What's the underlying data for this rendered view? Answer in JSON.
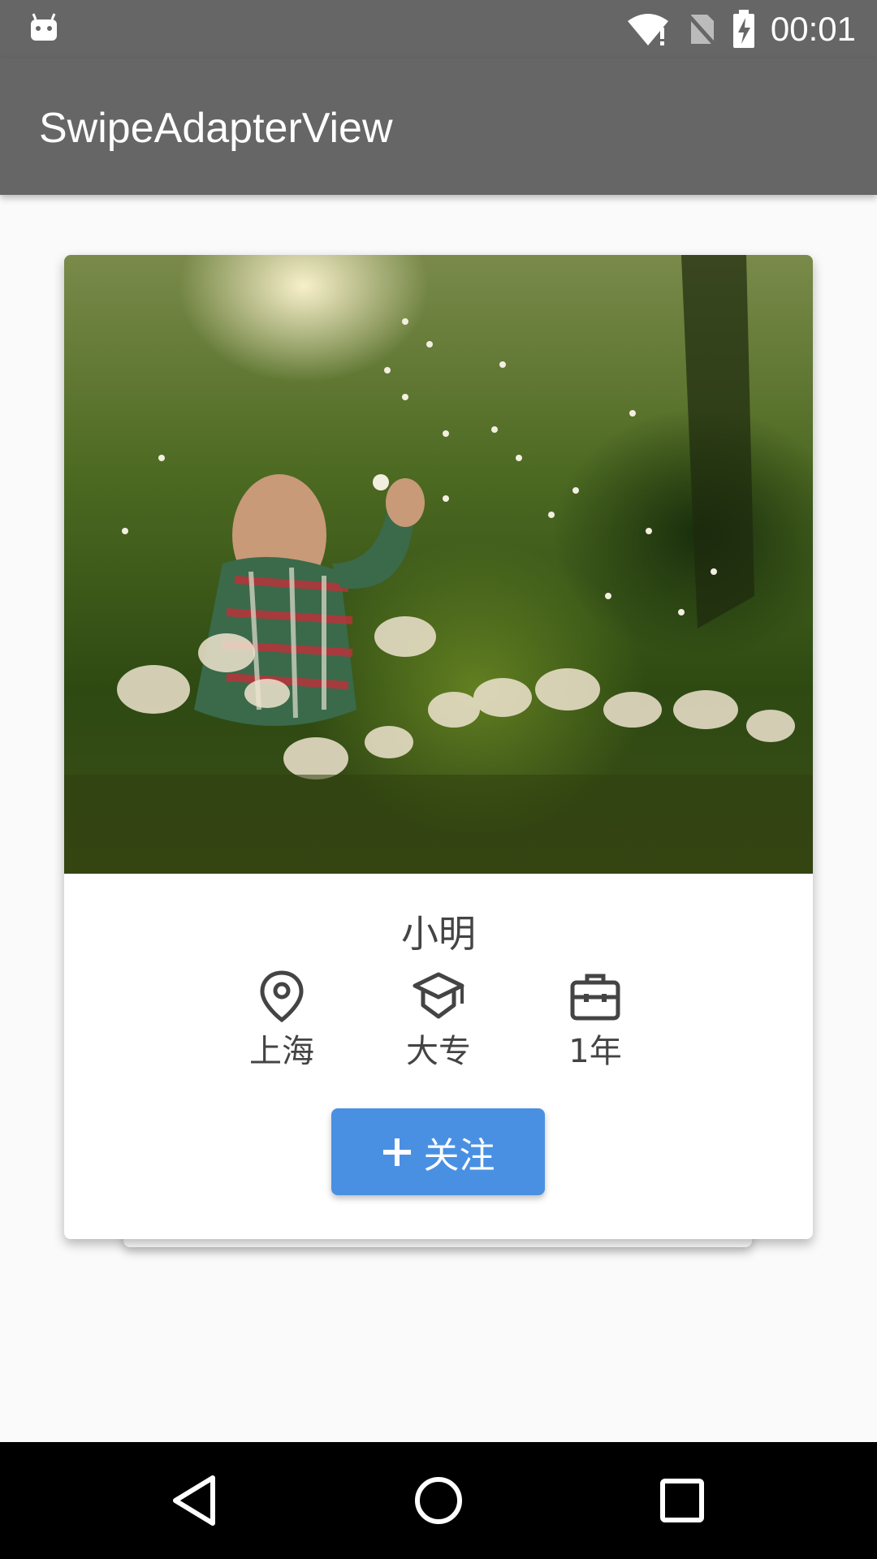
{
  "status_bar": {
    "time": "00:01"
  },
  "app_bar": {
    "title": "SwipeAdapterView"
  },
  "card": {
    "name": "小明",
    "location": "上海",
    "education": "大专",
    "experience": "1年",
    "follow_label": "关注"
  },
  "colors": {
    "status_bar": "#666666",
    "app_bar": "#666666",
    "accent_button": "#4a90e2",
    "background": "#fafafa",
    "nav_bar": "#000000"
  }
}
